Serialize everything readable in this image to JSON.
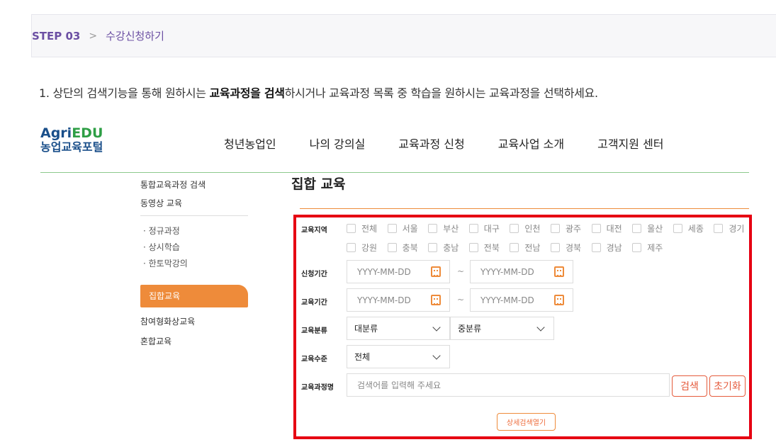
{
  "step": {
    "label": "STEP 03",
    "chevron": ">",
    "title": "수강신청하기"
  },
  "instruction": {
    "prefix": "1. 상단의 검색기능을 통해 원하시는 ",
    "bold": "교육과정을 검색",
    "suffix": "하시거나 교육과정 목록 중 학습을 원하시는 교육과정을 선택하세요."
  },
  "logo": {
    "brand_a": "Agri",
    "brand_b": "EDU",
    "subtitle": "농업교육포털"
  },
  "nav": [
    "청년농업인",
    "나의 강의실",
    "교육과정 신청",
    "교육사업 소개",
    "고객지원 센터"
  ],
  "sidebar": {
    "top_items": [
      "통합교육과정 검색",
      "동영상 교육"
    ],
    "sub_items": [
      "· 정규과정",
      "· 상시학습",
      "· 한토막강의"
    ],
    "active": "집합교육",
    "bottom_items": [
      "참여형화상교육",
      "혼합교육"
    ]
  },
  "page_title": "집합 교육",
  "search": {
    "region_label": "교육지역",
    "regions_row1": [
      "전체",
      "서울",
      "부산",
      "대구",
      "인천",
      "광주",
      "대전",
      "울산",
      "세종",
      "경기"
    ],
    "regions_row2": [
      "강원",
      "충북",
      "충남",
      "전북",
      "전남",
      "경북",
      "경남",
      "제주"
    ],
    "apply_period_label": "신청기간",
    "edu_period_label": "교육기간",
    "date_placeholder": "YYYY-MM-DD",
    "tilde": "~",
    "category_label": "교육분류",
    "category_major": "대분류",
    "category_minor": "중분류",
    "level_label": "교육수준",
    "level_value": "전체",
    "course_label": "교육과정명",
    "course_placeholder": "검색어를 입력해 주세요",
    "search_button": "검색",
    "reset_button": "초기화",
    "advanced_button": "상세검색열기"
  },
  "colors": {
    "step": "#6b4fa3",
    "accent": "#ee8b3a",
    "highlight_box": "#e60012",
    "button": "#e55b3c"
  }
}
